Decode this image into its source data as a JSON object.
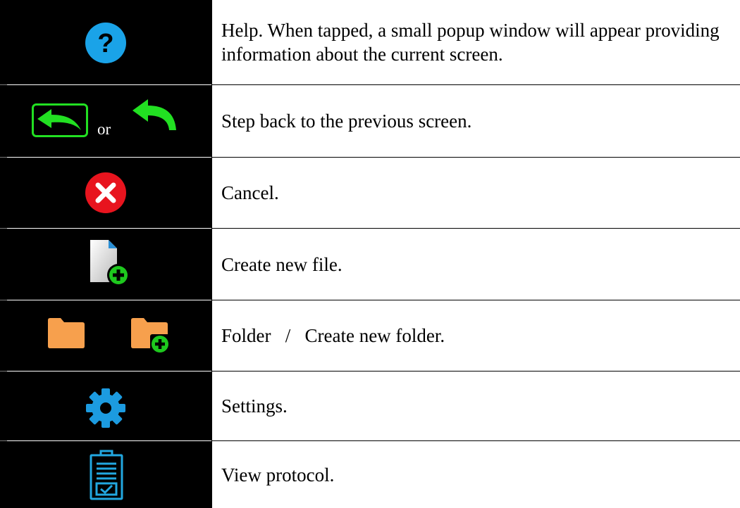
{
  "rows": [
    {
      "icons": [
        "help-icon"
      ],
      "description": "Help. When tapped, a small popup window will appear providing information about the current screen."
    },
    {
      "icons": [
        "back-button-icon",
        "back-arrow-icon"
      ],
      "connector": "or",
      "description": "Step back to the previous screen."
    },
    {
      "icons": [
        "cancel-icon"
      ],
      "description": "Cancel."
    },
    {
      "icons": [
        "new-file-icon"
      ],
      "description": "Create new file."
    },
    {
      "icons": [
        "folder-icon",
        "new-folder-icon"
      ],
      "description": "Folder   /   Create new folder."
    },
    {
      "icons": [
        "settings-icon"
      ],
      "description": "Settings."
    },
    {
      "icons": [
        "protocol-icon"
      ],
      "description": "View protocol."
    }
  ],
  "colors": {
    "icon_background": "#000000",
    "help_blue": "#1aa3e8",
    "back_green": "#22e022",
    "cancel_red": "#e8141e",
    "folder_orange": "#f7a04d",
    "plus_green": "#1ec81e",
    "settings_blue": "#1c9be0",
    "protocol_blue": "#22a7e0"
  }
}
